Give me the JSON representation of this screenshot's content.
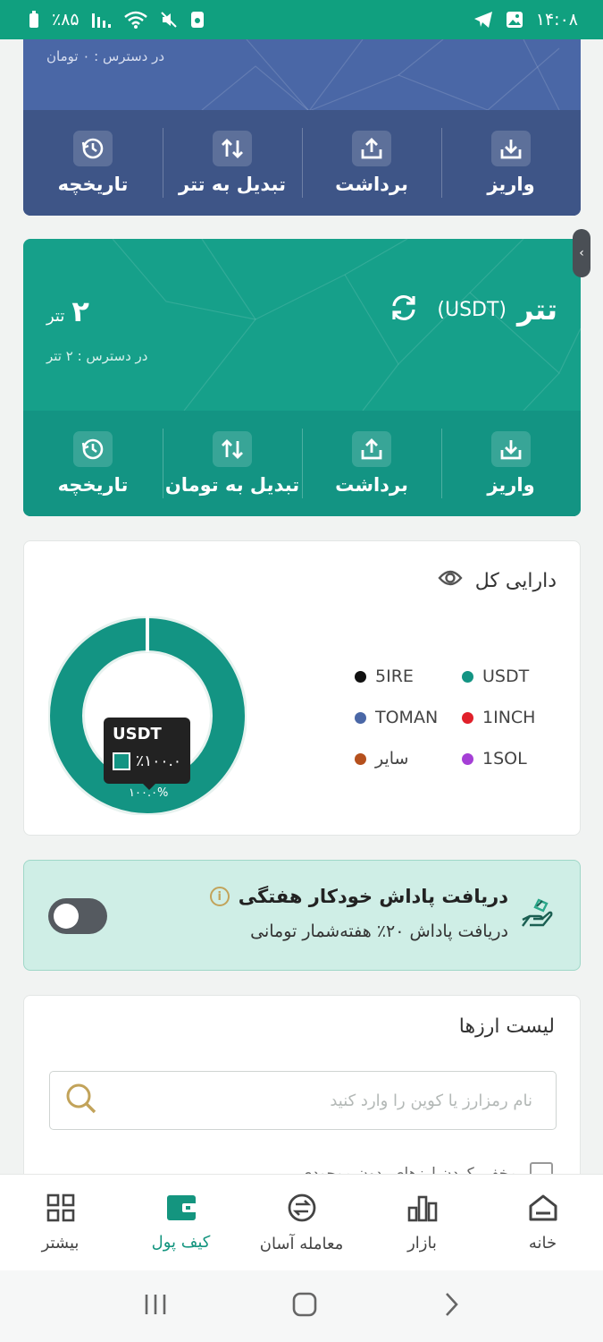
{
  "status_bar": {
    "time": "۱۴:۰۸",
    "battery": "٪۸۵"
  },
  "toman_card": {
    "available": "در دسترس : ۰ تومان",
    "actions": [
      {
        "id": "deposit",
        "label": "واریز",
        "icon": "download-icon"
      },
      {
        "id": "withdraw",
        "label": "برداشت",
        "icon": "upload-icon"
      },
      {
        "id": "convert",
        "label": "تبدیل به تتر",
        "icon": "swap-icon"
      },
      {
        "id": "history",
        "label": "تاریخچه",
        "icon": "history-icon"
      }
    ]
  },
  "usdt_card": {
    "name": "تتر",
    "symbol": "(USDT)",
    "balance": "۲",
    "balance_unit": "تتر",
    "available": "در دسترس : ۲ تتر",
    "actions": [
      {
        "id": "deposit",
        "label": "واریز",
        "icon": "download-icon"
      },
      {
        "id": "withdraw",
        "label": "برداشت",
        "icon": "upload-icon"
      },
      {
        "id": "convert",
        "label": "تبدیل به تومان",
        "icon": "swap-icon"
      },
      {
        "id": "history",
        "label": "تاریخچه",
        "icon": "history-icon"
      }
    ]
  },
  "assets": {
    "title": "دارایی کل",
    "legend": [
      {
        "label": "USDT",
        "color": "#139483"
      },
      {
        "label": "5IRE",
        "color": "#111111"
      },
      {
        "label": "1INCH",
        "color": "#e0202a"
      },
      {
        "label": "TOMAN",
        "color": "#4a67a6"
      },
      {
        "label": "1SOL",
        "color": "#a53fd6"
      },
      {
        "label": "سایر",
        "color": "#b5501d"
      }
    ],
    "tooltip": {
      "name": "USDT",
      "percent": "٪۱۰۰.۰"
    },
    "below_label": "۱۰۰.۰%",
    "share_usdt": 100
  },
  "reward": {
    "title": "دریافت پاداش خودکار هفتگی",
    "subtitle": "دریافت پاداش ۲۰٪ هفته‌شمار تومانی",
    "toggle_on": false
  },
  "coin_list": {
    "title": "لیست ارزها",
    "search_placeholder": "نام رمزارز یا کوین را وارد کنید",
    "hide_label": "مخفی کردن ارزهای بدون موجودی"
  },
  "bottom_nav": [
    {
      "id": "home",
      "label": "خانه",
      "icon": "home-icon",
      "active": false
    },
    {
      "id": "market",
      "label": "بازار",
      "icon": "bar-chart-icon",
      "active": false
    },
    {
      "id": "easy-trade",
      "label": "معامله آسان",
      "icon": "exchange-icon",
      "active": false
    },
    {
      "id": "wallet",
      "label": "کیف پول",
      "icon": "wallet-icon",
      "active": true
    },
    {
      "id": "more",
      "label": "بیشتر",
      "icon": "grid-icon",
      "active": false
    }
  ],
  "colors": {
    "brand": "#10a07f",
    "toman_card": "#4a67a6",
    "usdt_card": "#16a08a"
  }
}
